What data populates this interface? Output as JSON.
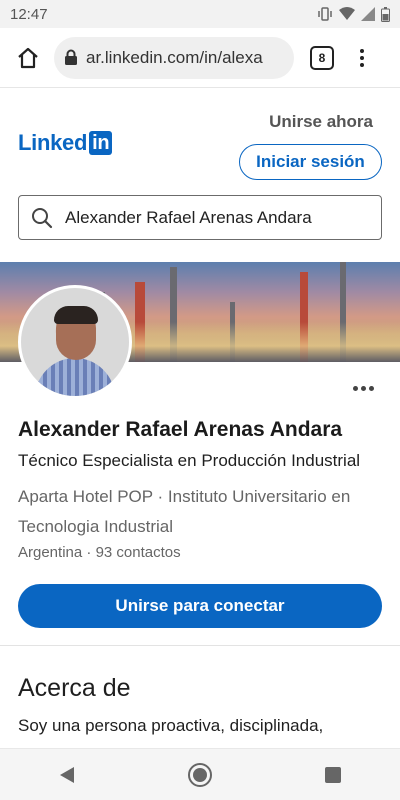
{
  "status_bar": {
    "time": "12:47"
  },
  "browser": {
    "url": "ar.linkedin.com/in/alexa",
    "tab_count": "8"
  },
  "linkedin": {
    "logo_text": "Linked",
    "logo_in": "in",
    "join_label": "Unirse ahora",
    "signin_label": "Iniciar sesión"
  },
  "search": {
    "value": "Alexander Rafael Arenas Andara"
  },
  "profile": {
    "name": "Alexander Rafael Arenas Andara",
    "headline": "Técnico Especialista en Producción Industrial",
    "affiliations": "Aparta Hotel POP · Instituto Universitario en Tecnologia Industrial",
    "location": "Argentina",
    "connections": "93 contactos",
    "connect_label": "Unirse para conectar"
  },
  "about": {
    "title": "Acerca de",
    "text": "Soy una persona proactiva, disciplinada,"
  }
}
